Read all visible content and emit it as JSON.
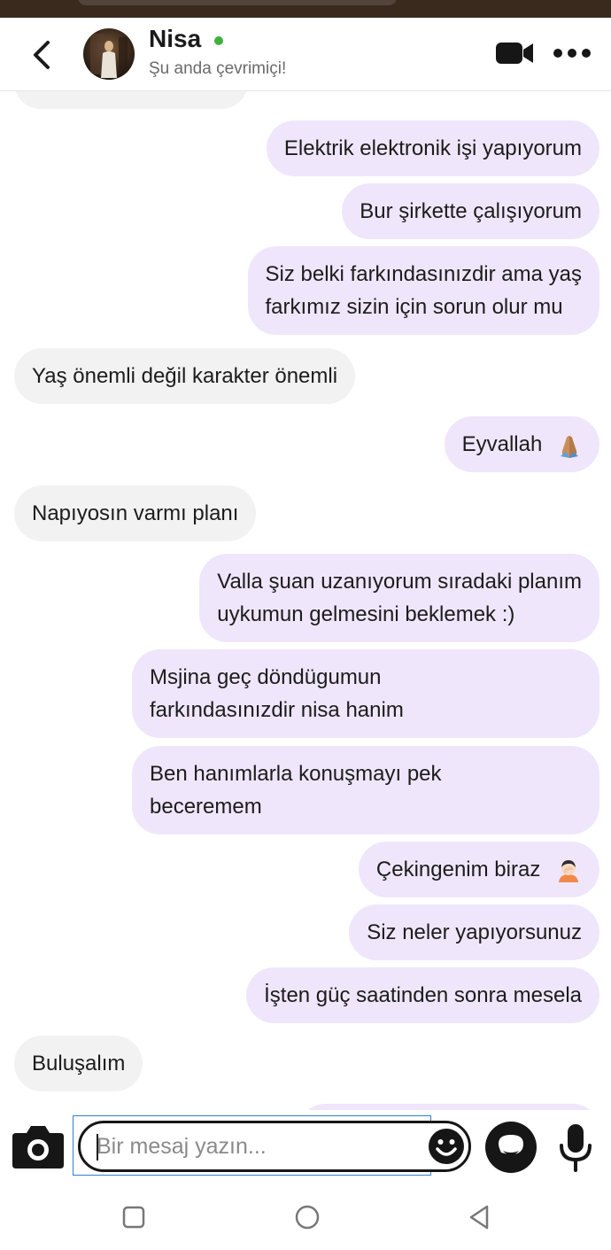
{
  "header": {
    "contact_name": "Nisa",
    "contact_status": "Şu anda çevrimiçi!",
    "online_color": "#3fb13f",
    "icons": {
      "back": "chevron-left-icon",
      "avatar": "avatar-photo",
      "video": "video-camera-icon",
      "more": "more-dots-icon"
    }
  },
  "messages": [
    {
      "dir": "in",
      "text": ""
    },
    {
      "dir": "out",
      "text": "Elektrik elektronik işi yapıyorum"
    },
    {
      "dir": "out",
      "text": "Bur şirkette çalışıyorum"
    },
    {
      "dir": "out",
      "line1": "Siz belki farkındasınızdir ama yaş",
      "line2": "farkımız sizin için sorun olur mu"
    },
    {
      "dir": "in",
      "text": "Yaş önemli değil karakter önemli"
    },
    {
      "dir": "out",
      "text": "Eyvallah",
      "emoji": "praying-hands-emoji"
    },
    {
      "dir": "in",
      "text": "Napıyosın varmı planı"
    },
    {
      "dir": "out",
      "line1": "Valla şuan uzanıyorum sıradaki planım",
      "line2": "uykumun gelmesini beklemek :)"
    },
    {
      "dir": "out",
      "line1": "Msjina geç döndügumun",
      "line2": "farkındasınızdir nisa hanim"
    },
    {
      "dir": "out",
      "line1": "Ben hanımlarla konuşmayı pek",
      "line2": "beceremem"
    },
    {
      "dir": "out",
      "text": "Çekingenim biraz",
      "emoji": "person-facepalming-emoji"
    },
    {
      "dir": "out",
      "text": "Siz neler yapıyorsunuz"
    },
    {
      "dir": "out",
      "text": "İşten güç saatinden sonra mesela"
    },
    {
      "dir": "in",
      "text": "Buluşalım"
    }
  ],
  "composer": {
    "placeholder": "Bir mesaj yazın...",
    "value": "",
    "icons": {
      "camera": "camera-icon",
      "emoji": "emoji-smiley-icon",
      "sticker": "sticker-chat-icon",
      "mic": "microphone-icon"
    }
  },
  "navbar": {
    "icons": [
      "recents-square-icon",
      "home-circle-icon",
      "back-triangle-icon"
    ]
  },
  "colors": {
    "outgoing_bubble": "#efe6fb",
    "incoming_bubble": "#f2f2f2",
    "status_bar": "#3a2a1e",
    "input_focus_border": "#2f7fd6"
  }
}
